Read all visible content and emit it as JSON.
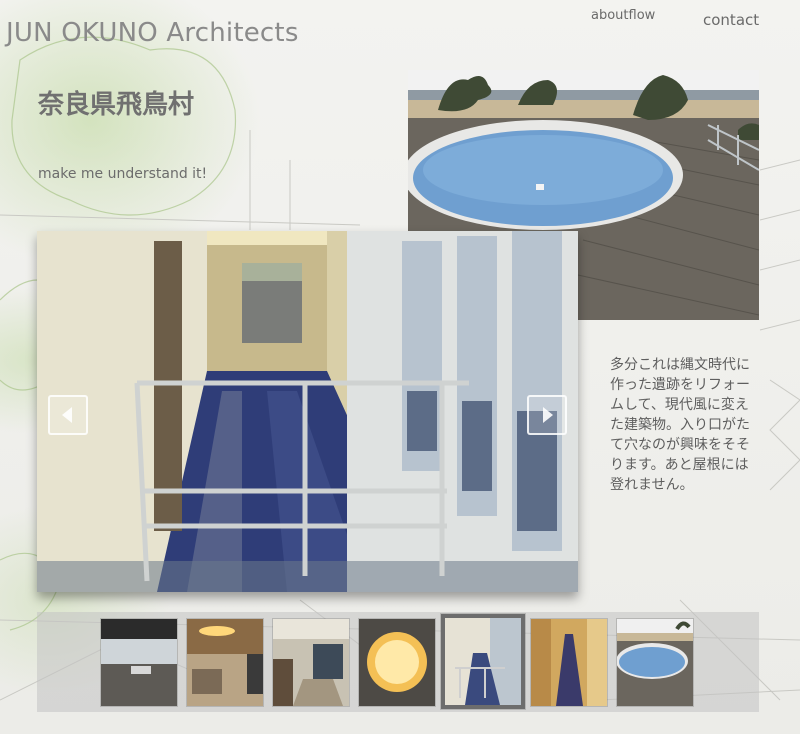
{
  "header": {
    "brand": "JUN OKUNO Architects",
    "nav": {
      "aboutflow": "aboutflow",
      "contact": "contact"
    }
  },
  "project": {
    "title": "奈良県飛鳥村",
    "tagline": "make me understand it!",
    "description": "多分これは縄文時代に作った遺跡をリフォームして、現代風に変えた建築物。入り口がたて穴なのが興味をそそります。あと屋根には登れません。"
  },
  "gallery": {
    "active_index": 4,
    "thumbs": [
      {
        "subject": "dark-room-with-tables"
      },
      {
        "subject": "round-ceiling-light-hall"
      },
      {
        "subject": "stairs-hall"
      },
      {
        "subject": "round-ceiling-light"
      },
      {
        "subject": "corridor-with-railing"
      },
      {
        "subject": "long-corridor"
      },
      {
        "subject": "round-pool"
      }
    ]
  },
  "icons": {
    "prev": "chevron-left-icon",
    "next": "chevron-right-icon"
  },
  "colors": {
    "brand_text": "#8a8a8a",
    "body_text": "#5e5e5e",
    "pool_water": "#6f9fd0"
  }
}
